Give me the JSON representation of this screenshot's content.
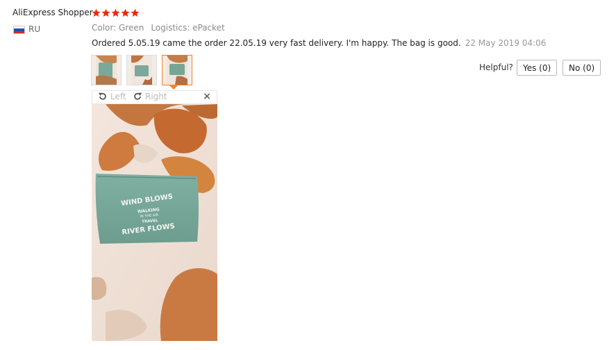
{
  "review": {
    "reviewer_name": "AliExpress Shopper",
    "rating": 5,
    "country_code": "RU",
    "color_label": "Color: Green",
    "logistics_label": "Logistics: ePacket",
    "feedback_text": "Ordered 5.05.19 came the order 22.05.19 very fast delivery. I'm happy. The bag is good.",
    "date": "22 May 2019 04:06"
  },
  "thumbnails": [
    {
      "id": "photo-1",
      "active": false
    },
    {
      "id": "photo-2",
      "active": false
    },
    {
      "id": "photo-3",
      "active": true
    }
  ],
  "viewer": {
    "rotate_left_label": "Left",
    "rotate_right_label": "Right",
    "close_symbol": "×",
    "bag_text_1": "WIND BLOWS",
    "bag_text_2": "WALKING",
    "bag_text_3": "IN THE AIR",
    "bag_text_4": "TRAVEL",
    "bag_text_5": "RIVER FLOWS"
  },
  "helpful": {
    "label": "Helpful?",
    "yes_label": "Yes (0)",
    "no_label": "No (0)"
  },
  "colors": {
    "star": "#e62e04",
    "accent": "#f0832a",
    "meta_text": "#888888"
  }
}
